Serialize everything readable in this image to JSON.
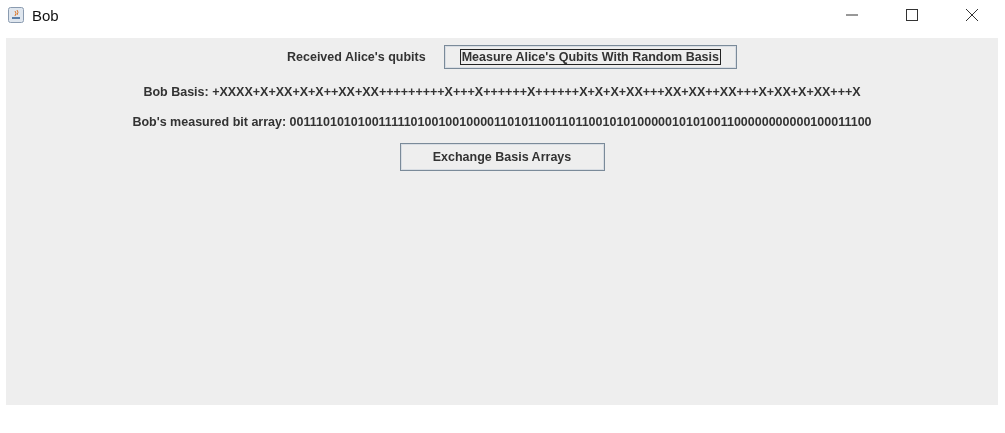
{
  "window": {
    "title": "Bob"
  },
  "received_label": "Received Alice's qubits",
  "measure_button": {
    "label": "Measure Alice's Qubits With Random Basis",
    "focused": true
  },
  "bob_basis": "Bob Basis: +XXXX+X+XX+X+X++XX+XX+++++++++X+++X++++++X++++++X+X+X+XX+++XX+XX++XX+++X+XX+X+XX+++X",
  "bit_array": "Bob's measured bit array: 0011101010100111110100100100001101011001101100101010000010101001100000000000100011100",
  "exchange_button": {
    "label": "Exchange Basis Arrays",
    "focused": false
  }
}
